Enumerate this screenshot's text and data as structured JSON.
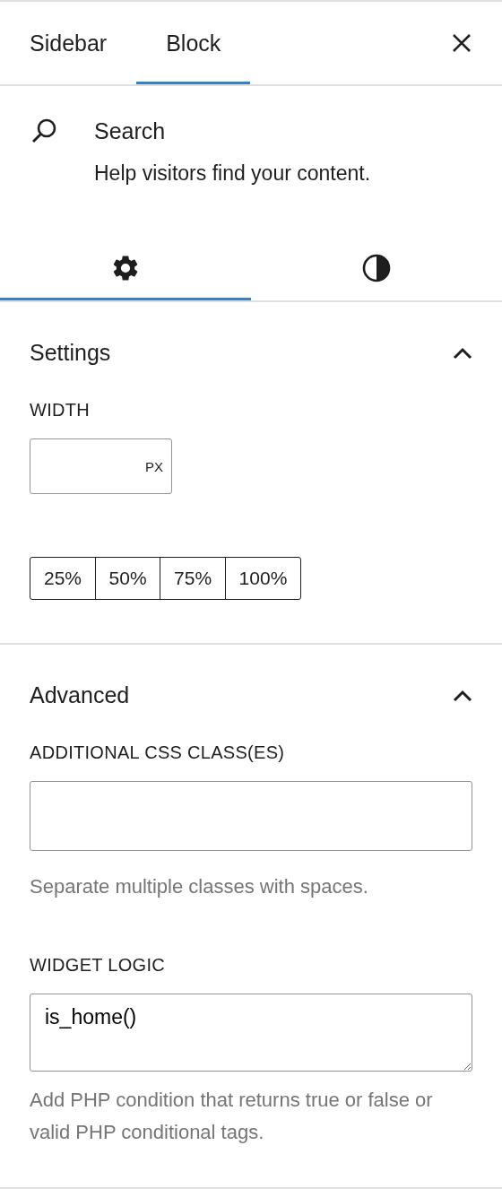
{
  "tabs": [
    {
      "label": "Sidebar",
      "selected": false
    },
    {
      "label": "Block",
      "selected": true
    }
  ],
  "block": {
    "title": "Search",
    "description": "Help visitors find your content."
  },
  "inspector_tabs": [
    {
      "kind": "settings",
      "selected": true
    },
    {
      "kind": "styles",
      "selected": false
    }
  ],
  "panels": [
    {
      "title": "Settings",
      "expanded": true,
      "fields": [
        {
          "kind": "unit",
          "label": "WIDTH",
          "unit": "PX"
        },
        {
          "kind": "buttons",
          "options": [
            {
              "label": "25%",
              "selected": false
            },
            {
              "label": "50%",
              "selected": false
            },
            {
              "label": "75%",
              "selected": false
            },
            {
              "label": "100%",
              "selected": false
            }
          ]
        }
      ]
    },
    {
      "title": "Advanced",
      "expanded": true,
      "fields": [
        {
          "kind": "text",
          "label": "ADDITIONAL CSS CLASS(ES)",
          "help": "Separate multiple classes with spaces."
        },
        {
          "kind": "textarea",
          "label": "WIDGET LOGIC",
          "value": "is_home()",
          "help": "Add PHP condition that returns true or false or valid PHP conditional tags."
        }
      ]
    }
  ]
}
